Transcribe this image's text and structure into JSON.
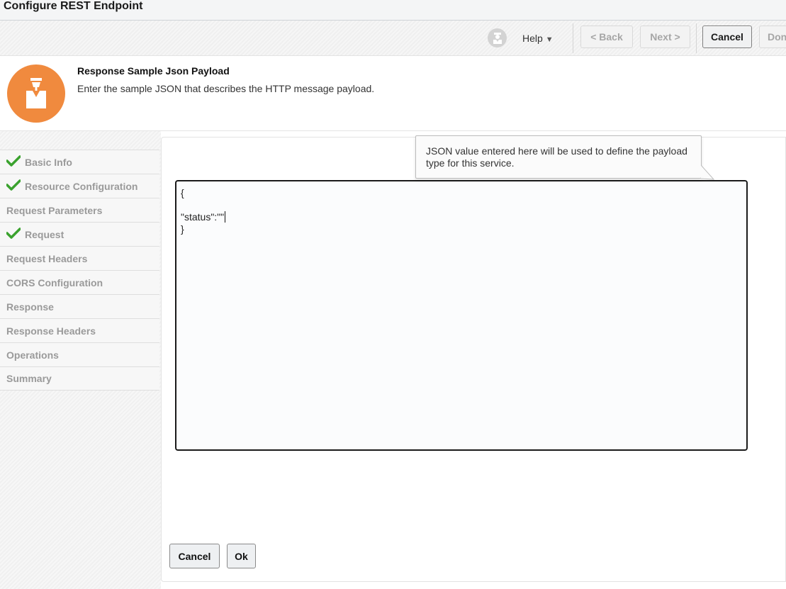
{
  "window": {
    "title": "Configure REST Endpoint"
  },
  "toolbar": {
    "help_label": "Help",
    "back_label": "< Back",
    "next_label": "Next >",
    "cancel_label": "Cancel",
    "done_label": "Don"
  },
  "header": {
    "title": "Response Sample Json Payload",
    "description": "Enter the sample JSON that describes the HTTP message payload.",
    "icon": "rest-endpoint-icon",
    "accent_color": "#f08a3e"
  },
  "nav": {
    "items": [
      {
        "label": "Basic Info",
        "checked": true
      },
      {
        "label": "Resource Configuration",
        "checked": true
      },
      {
        "label": "Request Parameters",
        "checked": false
      },
      {
        "label": "Request",
        "checked": true
      },
      {
        "label": "Request Headers",
        "checked": false
      },
      {
        "label": "CORS Configuration",
        "checked": false
      },
      {
        "label": "Response",
        "checked": false
      },
      {
        "label": "Response Headers",
        "checked": false
      },
      {
        "label": "Operations",
        "checked": false
      },
      {
        "label": "Summary",
        "checked": false
      }
    ]
  },
  "tooltip": {
    "text": "JSON value entered here will be used to define the payload type for this service."
  },
  "editor": {
    "lines": [
      "{",
      "",
      "\"status\":\"\"",
      "}"
    ]
  },
  "dialog": {
    "cancel_label": "Cancel",
    "ok_label": "Ok"
  }
}
